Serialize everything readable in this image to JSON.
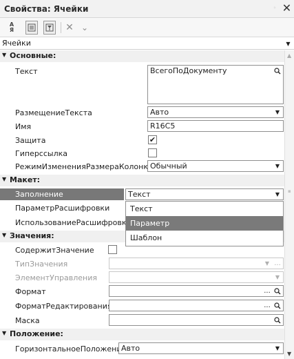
{
  "window": {
    "title": "Свойства: Ячейки"
  },
  "object": {
    "name": "Ячейки"
  },
  "groups": {
    "basic": "Основные:",
    "layout": "Макет:",
    "values": "Значения:",
    "position": "Положение:"
  },
  "props": {
    "text": {
      "label": "Текст",
      "value": "ВсегоПоДокументу"
    },
    "text_placement": {
      "label": "РазмещениеТекста",
      "value": "Авто"
    },
    "name": {
      "label": "Имя",
      "value": "R16C5"
    },
    "protection": {
      "label": "Защита",
      "checked": true
    },
    "hyperlink": {
      "label": "Гиперссылка",
      "checked": false
    },
    "col_resize": {
      "label": "РежимИзмененияРазмераКолонки",
      "value": "Обычный"
    },
    "fill": {
      "label": "Заполнение",
      "value": "Текст"
    },
    "decrypt_param": {
      "label": "ПараметрРасшифровки"
    },
    "decrypt_use": {
      "label": "ИспользованиеРасшифровки"
    },
    "contains_value": {
      "label": "СодержитЗначение",
      "checked": false
    },
    "value_type": {
      "label": "ТипЗначения"
    },
    "control": {
      "label": "ЭлементУправления"
    },
    "format": {
      "label": "Формат"
    },
    "edit_format": {
      "label": "ФорматРедактирования"
    },
    "mask": {
      "label": "Маска"
    },
    "h_pos": {
      "label": "ГоризонтальноеПоложение",
      "value": "Авто"
    }
  },
  "fill_options": [
    "Текст",
    "Параметр",
    "Шаблон"
  ],
  "fill_selected_option": "Параметр",
  "glyphs": {
    "close": "✕",
    "pin": "◦",
    "checkmark": "✔",
    "chevron_down": "▼",
    "search": "🔍",
    "ellipsis": "...",
    "sort_top": "А",
    "sort_bottom": "Я",
    "toolbar_x": "✕",
    "toolbar_chevron": "⌄"
  }
}
